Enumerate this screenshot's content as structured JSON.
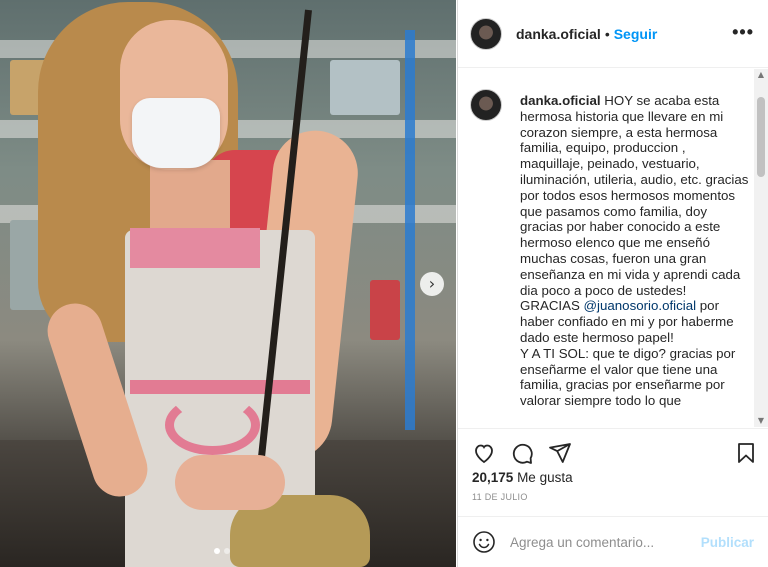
{
  "post": {
    "username": "danka.oficial",
    "separator": "•",
    "follow_label": "Seguir",
    "more_icon": "more-options-icon"
  },
  "caption": {
    "username": "danka.oficial",
    "text_part1": " HOY se acaba esta hermosa historia que llevare en mi corazon siempre, a esta hermosa familia, equipo, produccion , maquillaje, peinado, vestuario, iluminación, utileria, audio, etc. gracias por todos esos hermosos momentos que pasamos como familia, doy gracias por haber conocido a este hermoso elenco que me enseñó muchas cosas, fueron una gran enseñanza en mi vida y aprendi cada dia poco a poco de ustedes!\nGRACIAS ",
    "mention": "@juanosorio.oficial",
    "text_part2": " por haber confiado en mi y por haberme dado este hermoso papel!\nY A TI SOL: que te digo? gracias por enseñarme el valor que tiene una familia, gracias por enseñarme por valorar siempre todo lo que"
  },
  "stats": {
    "likes_count": "20,175",
    "likes_label": "Me gusta",
    "date": "11 DE JULIO"
  },
  "comment": {
    "placeholder": "Agrega un comentario...",
    "publish_label": "Publicar"
  },
  "photo": {
    "next_icon": "›"
  },
  "colors": {
    "accent": "#0095f6",
    "publish_disabled": "#b2dffc",
    "mention": "#00376b",
    "muted": "#8e8e8e"
  }
}
